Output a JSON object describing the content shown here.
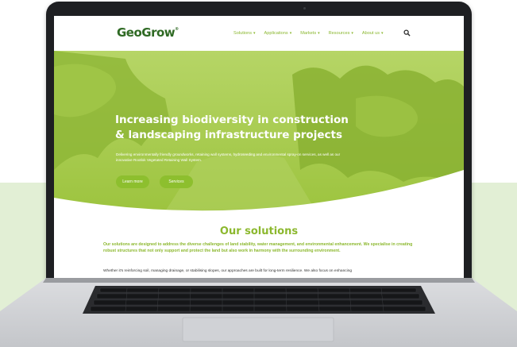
{
  "nav": {
    "logo": "GeoGrow",
    "logo_mark": "®",
    "menu": [
      {
        "label": "Solutions"
      },
      {
        "label": "Applications"
      },
      {
        "label": "Markets"
      },
      {
        "label": "Resources"
      },
      {
        "label": "About us"
      }
    ],
    "search_icon": "search-icon",
    "chevron_icon": "chevron-down-icon"
  },
  "hero": {
    "title": "Increasing biodiversity in construction & landscaping infrastructure projects",
    "subtitle": "Delivering environmentally friendly groundworks, retaining wall systems, hydroseeding and environmental spray-on services, as well as our innovative Rootlok Vegetated Retaining Wall System.",
    "buttons": [
      "Learn more",
      "Services"
    ]
  },
  "solutions": {
    "title": "Our solutions",
    "intro": "Our solutions are designed to address the diverse challenges of land stability, water management, and environmental enhancement. We specialise in creating robust structures that not only support and protect the land but also work in harmony with the surrounding environment.",
    "body": "Whether it's reinforcing soil, managing drainage, or stabilising slopes, our approaches are built for long-term resilience. We also focus on enhancing"
  },
  "colors": {
    "brand_green": "#8cb82e",
    "logo_green": "#2f6a24",
    "hero_overlay": "#9cc23a",
    "background_tint": "#e2efd5"
  }
}
